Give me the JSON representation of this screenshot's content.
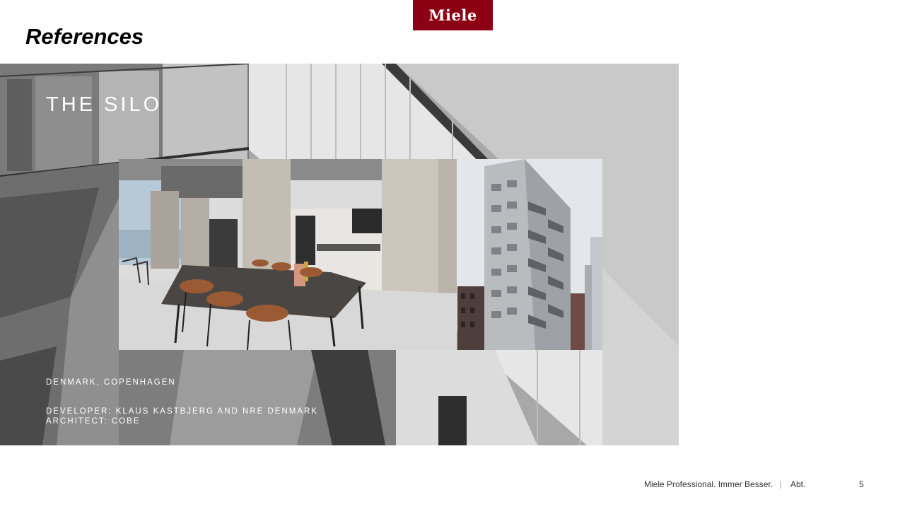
{
  "brand": {
    "logo_text": "Miele",
    "color": "#8c0014"
  },
  "slide": {
    "title": "References",
    "page_number": "5"
  },
  "project": {
    "name": "THE SILO",
    "location": "DENMARK, COPENHAGEN",
    "developer": "DEVELOPER: KLAUS KASTBJERG AND NRE DENMARK",
    "architect": "ARCHITECT: COBE"
  },
  "footer": {
    "tagline": "Miele Professional. Immer Besser.",
    "separator": "|",
    "department": "Abt."
  },
  "images": {
    "background": "building-facade-photo",
    "interior": "dining-room-interior-photo",
    "exterior": "silo-tower-exterior-photo"
  }
}
